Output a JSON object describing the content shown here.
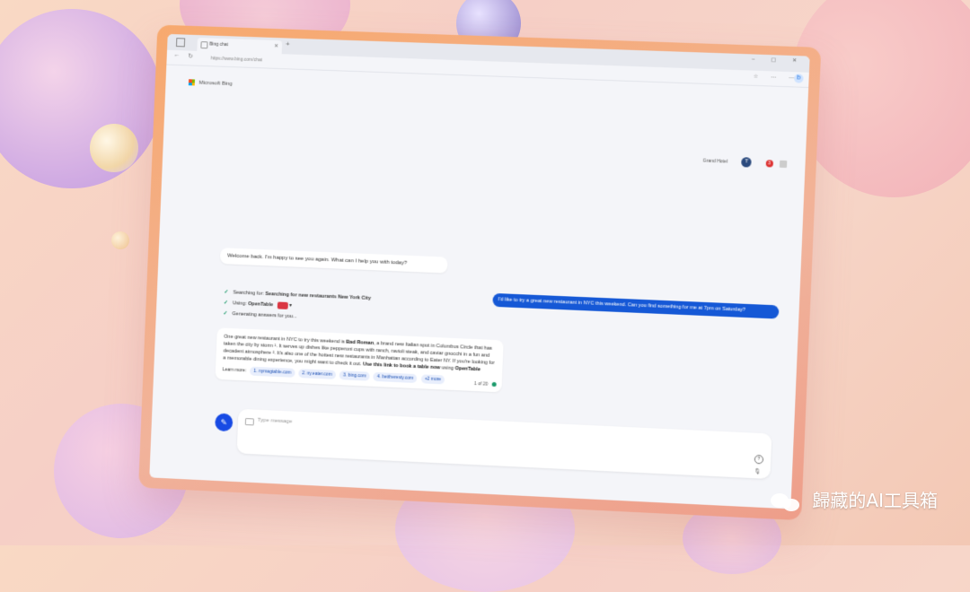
{
  "browser": {
    "tab_title": "Bing chat",
    "url": "https://www.bing.com/chat",
    "new_tab": "+",
    "window_controls": "–  ▢  ✕",
    "nav_back": "←",
    "nav_refresh": "↻",
    "tools": "☆ ⋯ ⋯"
  },
  "header": {
    "brand": "Microsoft Bing",
    "right_label": "Grand Hotel",
    "avatar_initial": "T",
    "notif_count": "3"
  },
  "chat": {
    "welcome": "Welcome back. I'm happy to see you again. What can I help you with today?",
    "user_message": "I'd like to try a great new restaurant in NYC this weekend. Can you find something for me at 7pm on Saturday?",
    "status": {
      "search_prefix": "Searching for:",
      "search_query": "Searching for new restaurants New York City",
      "using_prefix": "Using:",
      "using_plugin": "OpenTable",
      "generating": "Generating answers for you..."
    },
    "answer": {
      "p1": "One great new restaurant in NYC to try this weekend is",
      "restaurant": "Bad Roman",
      "p2": ", a brand new Italian spot in Columbus Circle that has taken the city by storm ¹. It serves up dishes like pepperoni cups with ranch, ravioli steak, and caviar gnocchi in a fun and decadent atmosphere ². It's also one of the hottest new restaurants in Manhattan according to Eater NY. If you're looking for a memorable dining experience, you might want to check it out.",
      "link_text": "Use this link to book a table now",
      "p3": "using",
      "link_service": "OpenTable",
      "learn_more": "Learn more:",
      "sources": [
        "1. nymagtable.com",
        "2. ny.eater.com",
        "3. bing.com",
        "4. bettheresty.com",
        "+2 more"
      ],
      "pager": "1 of 20"
    },
    "composer_placeholder": "Type message",
    "help_icon": "?",
    "mic_icon": "🎙"
  },
  "watermark": "歸藏的AI工具箱"
}
